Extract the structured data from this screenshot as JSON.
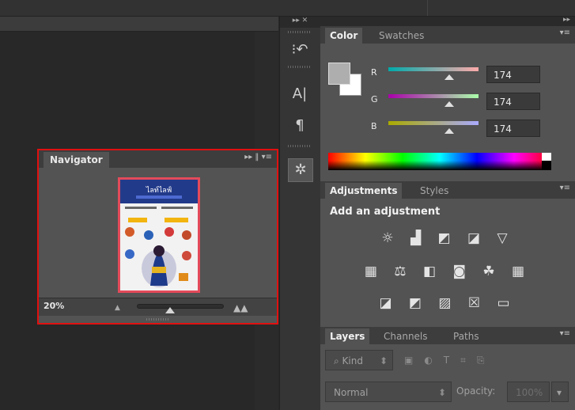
{
  "tool_strip": {
    "collapse_label": "▸▸ ✕",
    "tools": [
      {
        "name": "history-icon",
        "glyph": "⁝↶"
      },
      {
        "name": "character-icon",
        "glyph": "A|"
      },
      {
        "name": "paragraph-icon",
        "glyph": "¶"
      },
      {
        "name": "navigator-icon",
        "glyph": "✲"
      }
    ]
  },
  "navigator": {
    "tab_label": "Navigator",
    "controls": "▸▸ ‖ ▾≡",
    "zoom": "20%",
    "zoom_level": 0.2,
    "thumbnail": {
      "title": "ไลท์ไลฟ์",
      "border_color": "#e34a5a"
    }
  },
  "color_panel": {
    "tabs": [
      "Color",
      "Swatches"
    ],
    "active_tab": "Color",
    "foreground": "#aeaeae",
    "background": "#ffffff",
    "channels": [
      {
        "label": "R",
        "value": "174"
      },
      {
        "label": "G",
        "value": "174"
      },
      {
        "label": "B",
        "value": "174"
      }
    ]
  },
  "adjustments_panel": {
    "tabs": [
      "Adjustments",
      "Styles"
    ],
    "active_tab": "Adjustments",
    "heading": "Add an adjustment",
    "rows": [
      [
        "brightness-contrast-icon",
        "levels-icon",
        "curves-icon",
        "exposure-icon",
        "gradient-triangle-icon"
      ],
      [
        "vibrance-icon",
        "color-balance-icon",
        "black-white-icon",
        "photo-filter-icon",
        "channel-mixer-icon",
        "color-lookup-icon"
      ],
      [
        "invert-icon",
        "posterize-icon",
        "threshold-icon",
        "selective-color-icon",
        "gradient-map-icon"
      ]
    ],
    "row_glyphs": [
      "☼ ▟ ◩ ◪ ▽",
      "▦ ⚖ ◧ ◙ ☘ ▦",
      "◪ ◩ ▨ ☒ ▭"
    ]
  },
  "layers_panel": {
    "tabs": [
      "Layers",
      "Channels",
      "Paths"
    ],
    "active_tab": "Layers",
    "filter_kind": "Kind",
    "blend_mode": "Normal",
    "opacity_label": "Opacity:",
    "opacity_value": "100%"
  },
  "colors": {
    "highlight": "#e01010",
    "panel": "#535353"
  }
}
